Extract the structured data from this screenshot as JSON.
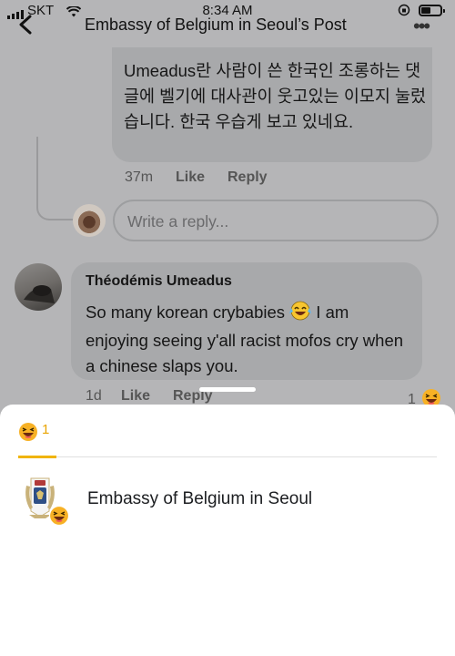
{
  "status_bar": {
    "carrier": "SKT",
    "time": "8:34 AM"
  },
  "nav": {
    "title": "Embassy of Belgium in Seoul’s Post",
    "more": "•••"
  },
  "comment1": {
    "text": "Umeadus란 사람이 쓴 한국인 조롱하는 댓글에 벨기에 대사관이 웃고있는 이모지 눌렀습니다. 한국 우습게 보고 있네요.",
    "time": "37m",
    "like": "Like",
    "reply": "Reply"
  },
  "reply_box": {
    "placeholder": "Write a reply..."
  },
  "comment2": {
    "author": "Théodémis Umeadus",
    "text_before_emoji": "So many korean crybabies ",
    "text_after_emoji": " I am enjoying seeing y'all racist mofos cry when a chinese slaps you.",
    "time": "1d",
    "like": "Like",
    "reply": "Reply",
    "reaction_count": "1"
  },
  "reactions_sheet": {
    "tab_count": "1",
    "tab_icon": "haha-reaction-icon",
    "people": [
      {
        "name": "Embassy of Belgium in Seoul",
        "reaction_icon": "haha-reaction-icon"
      }
    ]
  },
  "colors": {
    "reaction_yellow": "#f7b125",
    "dim_bg": "#b5b5b7",
    "bubble": "#a8a9ab"
  }
}
